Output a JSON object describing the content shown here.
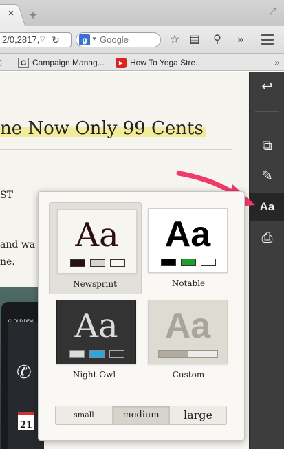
{
  "toolbar": {
    "url_text": "2/0,2817,",
    "search_placeholder": "Google",
    "search_engine_letter": "g"
  },
  "tabbar": {
    "close_glyph": "×",
    "newtab_glyph": "+"
  },
  "bookmarks": {
    "items": [
      {
        "label": "Campaign Manag...",
        "icon": "google-favicon"
      },
      {
        "label": "How To Yoga Stre...",
        "icon": "youtube-favicon"
      }
    ],
    "more": "»"
  },
  "article": {
    "headline": "ne Now Only 99 Cents",
    "line1": "ST",
    "line2": "and wa",
    "line3": "ne.",
    "phone_date": "21",
    "phone_tabs": "CLOUD  DEVI",
    "phone_label": "Phone"
  },
  "sidebar": {
    "buttons": [
      {
        "icon": "back-arrow-icon",
        "glyph": "↩"
      },
      {
        "icon": "evernote-clip-icon",
        "glyph": "⧉"
      },
      {
        "icon": "edit-text-icon",
        "glyph": "✎"
      },
      {
        "icon": "text-style-icon",
        "glyph": "Aa"
      },
      {
        "icon": "printer-icon",
        "glyph": "⎙"
      }
    ]
  },
  "popup": {
    "themes": [
      {
        "name": "Newsprint",
        "sample": "Aa",
        "bg": "#f7f5ef",
        "fg": "#2a0f12",
        "swatches": [
          "#2a0f12",
          "#d8d4cc",
          "#f7f5ef"
        ],
        "selected": true
      },
      {
        "name": "Notable",
        "sample": "Aa",
        "bg": "#ffffff",
        "fg": "#000000",
        "swatches": [
          "#000000",
          "#1f9e2e",
          "#ffffff"
        ],
        "selected": false
      },
      {
        "name": "Night Owl",
        "sample": "Aa",
        "bg": "#333333",
        "fg": "#dcdcdc",
        "swatches": [
          "#dcdcdc",
          "#2aa7e0",
          "#333333"
        ],
        "selected": false
      },
      {
        "name": "Custom",
        "sample": "Aa",
        "bg": "#dedbd3",
        "fg": "#a9a49c",
        "swatches": [
          "#b0aca4",
          "#eeece6"
        ],
        "selected": false
      }
    ],
    "sizes": [
      {
        "label": "small",
        "active": false
      },
      {
        "label": "medium",
        "active": true
      },
      {
        "label": "large",
        "active": false
      }
    ]
  },
  "colors": {
    "arrow": "#f03a6a",
    "sidebar_bg": "#3d3d3d",
    "highlight": "#f2ec9a"
  }
}
